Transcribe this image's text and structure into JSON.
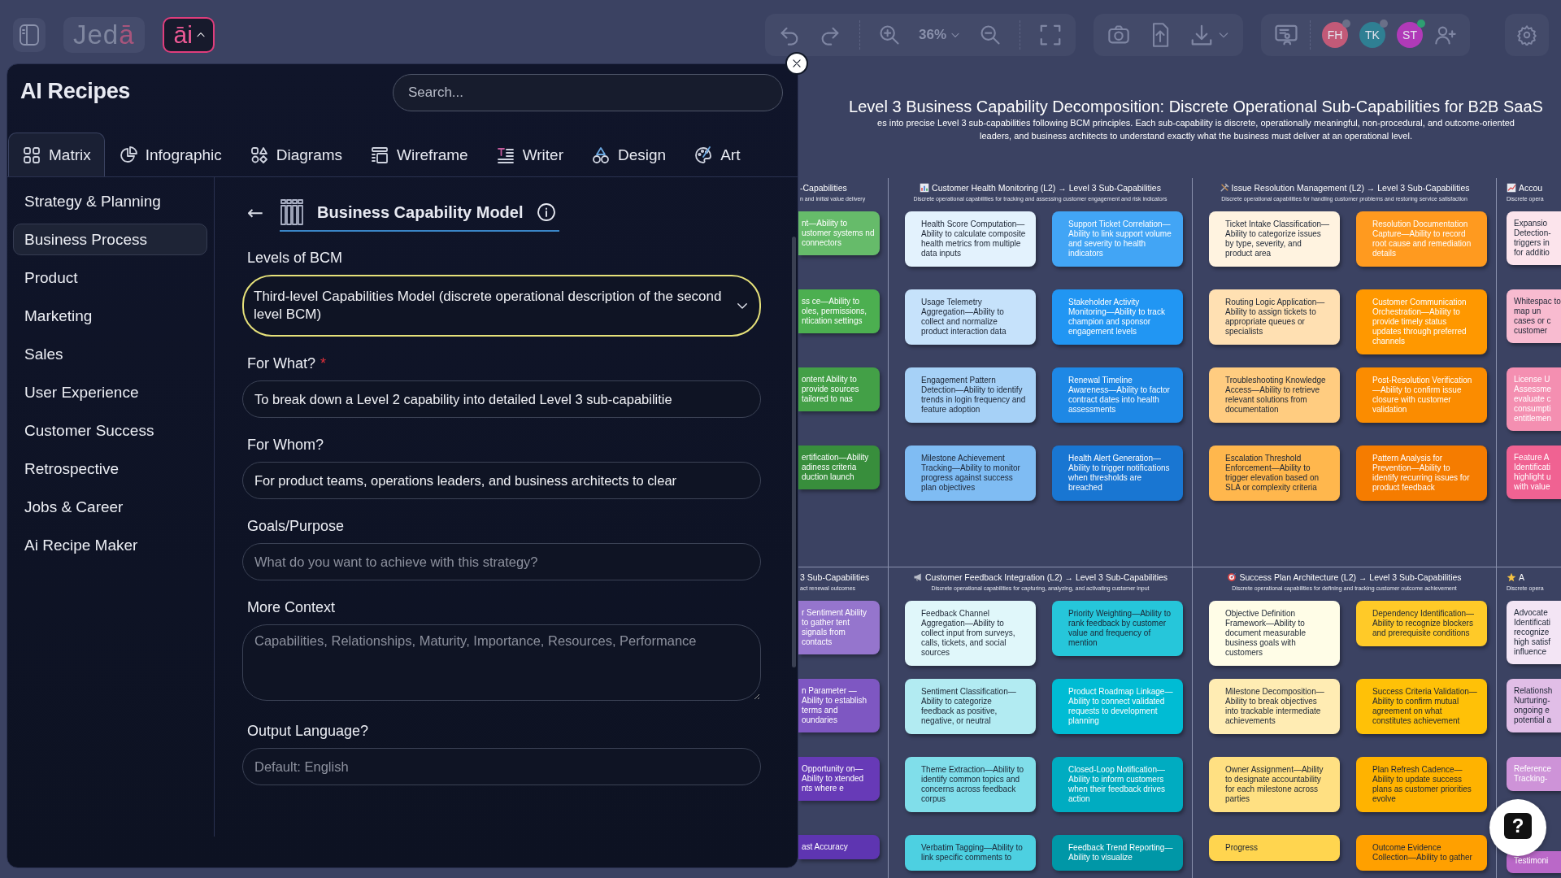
{
  "topbar": {
    "logo": {
      "text": "Jed",
      "accent": "ā"
    },
    "ai_button": {
      "label": "āi",
      "expanded": true
    },
    "zoom": "36%",
    "avatars": [
      {
        "initials": "FH",
        "color": "#c25a78",
        "online": false
      },
      {
        "initials": "TK",
        "color": "#2f7f93",
        "online": false
      },
      {
        "initials": "ST",
        "color": "#b03ab8",
        "online": true
      }
    ]
  },
  "panel": {
    "title": "AI Recipes",
    "search": {
      "placeholder": "Search..."
    },
    "tabs": [
      {
        "label": "Matrix",
        "selected": true
      },
      {
        "label": "Infographic",
        "selected": false
      },
      {
        "label": "Diagrams",
        "selected": false
      },
      {
        "label": "Wireframe",
        "selected": false
      },
      {
        "label": "Writer",
        "selected": false
      },
      {
        "label": "Design",
        "selected": false
      },
      {
        "label": "Art",
        "selected": false
      }
    ],
    "categories": [
      {
        "label": "Strategy & Planning",
        "selected": false
      },
      {
        "label": "Business Process",
        "selected": true
      },
      {
        "label": "Product",
        "selected": false
      },
      {
        "label": "Marketing",
        "selected": false
      },
      {
        "label": "Sales",
        "selected": false
      },
      {
        "label": "User Experience",
        "selected": false
      },
      {
        "label": "Customer Success",
        "selected": false
      },
      {
        "label": "Retrospective",
        "selected": false
      },
      {
        "label": "Jobs & Career",
        "selected": false
      },
      {
        "label": "Ai Recipe Maker",
        "selected": false
      }
    ],
    "recipe": {
      "back": "←",
      "title": "Business Capability Model"
    },
    "fields": [
      {
        "kind": "select",
        "label": "Levels of BCM",
        "value": "Third-level Capabilities Model (discrete operational description of the second level BCM)"
      },
      {
        "kind": "input",
        "label": "For What?",
        "required_mark": "*",
        "value": "To break down a Level 2 capability into detailed Level 3 sub-capabilitie"
      },
      {
        "kind": "input",
        "label": "For Whom?",
        "value": "For product teams, operations leaders, and business architects to clear"
      },
      {
        "kind": "input",
        "label": "Goals/Purpose",
        "placeholder": "What do you want to achieve with this strategy?"
      },
      {
        "kind": "textarea",
        "label": "More Context",
        "placeholder": "Capabilities, Relationships, Maturity, Importance, Resources, Performance"
      },
      {
        "kind": "input",
        "label": "Output Language?",
        "placeholder": "Default: English"
      }
    ]
  },
  "canvas": {
    "title": "Level 3 Business Capability Decomposition: Discrete Operational Sub-Capabilities for B2B SaaS",
    "subtitle_lines": [
      "es into precise Level 3 sub-capabilities following BCM principles. Each sub-capability is discrete, operationally meaningful, non-procedural, and outcome-oriented",
      "leaders, and business architects to understand exactly what the business must deliver at an operational level."
    ],
    "bands": [
      {
        "columns": [
          {
            "kind": "partial-left",
            "title": "-Capabilities",
            "subtitle": "n and initial value delivery",
            "cards": [
              {
                "text": "nt—Ability to ustomer systems nd connectors",
                "color": "#66bb6a"
              },
              {
                "text": "ss ce—Ability to oles, permissions, ntication settings",
                "color": "#4caf50"
              },
              {
                "text": "ontent Ability to provide sources tailored to nas",
                "color": "#43a047"
              },
              {
                "text": "ertification—Ability adiness criteria duction launch",
                "color": "#388e3c"
              }
            ]
          },
          {
            "kind": "full",
            "title": "Customer Health Monitoring (L2) → Level 3 Sub-Capabilities",
            "subtitle": "Discrete operational capabilities for tracking and assessing customer engagement and risk indicators",
            "cards": [
              {
                "text": "Health Score Computation—Ability to calculate composite health metrics from multiple data inputs",
                "color": "#e3f2fd"
              },
              {
                "text": "Support Ticket Correlation—Ability to link support volume and severity to health indicators",
                "color": "#42a5f5"
              },
              {
                "text": "Usage Telemetry Aggregation—Ability to collect and normalize product interaction data",
                "color": "#c6e2fb"
              },
              {
                "text": "Stakeholder Activity Monitoring—Ability to track champion and sponsor engagement levels",
                "color": "#2196f3"
              },
              {
                "text": "Engagement Pattern Detection—Ability to identify trends in login frequency and feature adoption",
                "color": "#a6d1f7"
              },
              {
                "text": "Renewal Timeline Awareness—Ability to factor contract dates into health assessments",
                "color": "#1e88e5"
              },
              {
                "text": "Milestone Achievement Tracking—Ability to monitor progress against success plan objectives",
                "color": "#7fbcf3"
              },
              {
                "text": "Health Alert Generation—Ability to trigger notifications when thresholds are breached",
                "color": "#1976d2"
              }
            ]
          },
          {
            "kind": "full",
            "title": "Issue Resolution Management (L2) → Level 3 Sub-Capabilities",
            "subtitle": "Discrete operational capabilities for handling customer problems and restoring service satisfaction",
            "cards": [
              {
                "text": "Ticket Intake Classification—Ability to categorize issues by type, severity, and product area",
                "color": "#fff3e0"
              },
              {
                "text": "Resolution Documentation Capture—Ability to record root cause and remediation details",
                "color": "#ff9a1f"
              },
              {
                "text": "Routing Logic Application—Ability to assign tickets to appropriate queues or specialists",
                "color": "#ffe0b2"
              },
              {
                "text": "Customer Communication Orchestration—Ability to provide timely status updates through preferred channels",
                "color": "#ff9800"
              },
              {
                "text": "Troubleshooting Knowledge Access—Ability to retrieve relevant solutions from documentation",
                "color": "#ffcc80"
              },
              {
                "text": "Post-Resolution Verification—Ability to confirm issue closure with customer validation",
                "color": "#fb8c00"
              },
              {
                "text": "Escalation Threshold Enforcement—Ability to trigger elevation based on SLA or complexity criteria",
                "color": "#ffb74d"
              },
              {
                "text": "Pattern Analysis for Prevention—Ability to identify recurring issues for product feedback",
                "color": "#f57c00"
              }
            ]
          },
          {
            "kind": "partial-right",
            "title": "Accou",
            "subtitle": "Discrete opera",
            "cards": [
              {
                "text": "Expansio Detection- triggers in for additio",
                "color": "#fce4ec"
              },
              {
                "text": "Whitespac to map un cases or c customer",
                "color": "#f8bbd0"
              },
              {
                "text": "License U Assessme evaluate c consumpti entitlemen",
                "color": "#f48fb1"
              },
              {
                "text": "Feature A Identificati highlight u with value",
                "color": "#f06292"
              }
            ]
          }
        ]
      },
      {
        "columns": [
          {
            "kind": "partial-left",
            "title": "3 Sub-Capabilities",
            "subtitle": "act renewal outcomes",
            "cards": [
              {
                "text": "r Sentiment Ability to gather tent signals from contacts",
                "color": "#9575cd"
              },
              {
                "text": "n Parameter —Ability to establish terms and oundaries",
                "color": "#7e57c2"
              },
              {
                "text": "Opportunity on—Ability to xtended nts where e",
                "color": "#673ab7"
              },
              {
                "text": "ast Accuracy",
                "color": "#5e35b1"
              }
            ]
          },
          {
            "kind": "full",
            "title": "Customer Feedback Integration (L2) → Level 3 Sub-Capabilities",
            "subtitle": "Discrete operational capabilities for capturing, analyzing, and activating customer input",
            "cards": [
              {
                "text": "Feedback Channel Aggregation—Ability to collect input from surveys, calls, tickets, and social sources",
                "color": "#e0f7fa"
              },
              {
                "text": "Priority Weighting—Ability to rank feedback by customer value and frequency of mention",
                "color": "#26c6da"
              },
              {
                "text": "Sentiment Classification—Ability to categorize feedback as positive, negative, or neutral",
                "color": "#b2ebf2"
              },
              {
                "text": "Product Roadmap Linkage—Ability to connect validated requests to development planning",
                "color": "#00bcd4"
              },
              {
                "text": "Theme Extraction—Ability to identify common topics and concerns across feedback corpus",
                "color": "#80deea"
              },
              {
                "text": "Closed-Loop Notification—Ability to inform customers when their feedback drives action",
                "color": "#00acc1"
              },
              {
                "text": "Verbatim Tagging—Ability to link specific comments to",
                "color": "#4dd0e1"
              },
              {
                "text": "Feedback Trend Reporting—Ability to visualize",
                "color": "#0097a7"
              }
            ]
          },
          {
            "kind": "full",
            "title": "Success Plan Architecture (L2) → Level 3 Sub-Capabilities",
            "subtitle": "Discrete operational capabilities for defining and tracking customer outcome achievement",
            "cards": [
              {
                "text": "Objective Definition Framework—Ability to document measurable business goals with customers",
                "color": "#fffde7"
              },
              {
                "text": "Dependency Identification—Ability to recognize blockers and prerequisite conditions",
                "color": "#ffca28"
              },
              {
                "text": "Milestone Decomposition—Ability to break objectives into trackable intermediate achievements",
                "color": "#ffecb3"
              },
              {
                "text": "Success Criteria Validation—Ability to confirm mutual agreement on what constitutes achievement",
                "color": "#ffc107"
              },
              {
                "text": "Owner Assignment—Ability to designate accountability for each milestone across parties",
                "color": "#ffe082"
              },
              {
                "text": "Plan Refresh Cadence—Ability to update success plans as customer priorities evolve",
                "color": "#ffb300"
              },
              {
                "text": "Progress",
                "color": "#ffd54f"
              },
              {
                "text": "Outcome Evidence Collection—Ability to gather",
                "color": "#ffa000"
              }
            ]
          },
          {
            "kind": "partial-right",
            "title": "A",
            "subtitle": "Discrete opera",
            "cards": [
              {
                "text": "Advocate Identificati recognize high satisf influence",
                "color": "#f3e5f5"
              },
              {
                "text": "Relationsh Nurturing- ongoing e potential a",
                "color": "#e1bee7"
              },
              {
                "text": "Reference Tracking-",
                "color": "#ce93d8"
              },
              {
                "text": "Testimoni",
                "color": "#ba68c8"
              }
            ]
          }
        ]
      }
    ]
  },
  "help": {
    "label": "?"
  }
}
